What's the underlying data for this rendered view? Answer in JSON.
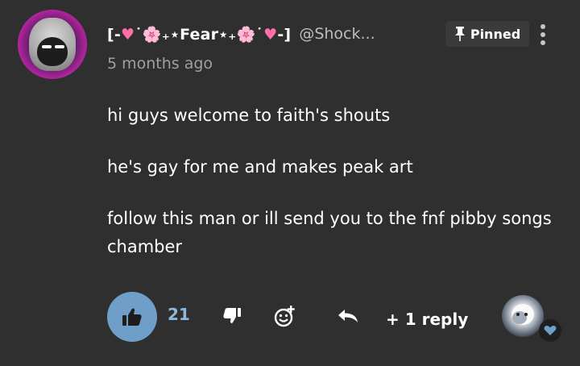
{
  "shout": {
    "author": {
      "display_name_prefix": "[-",
      "display_name_heart_left": "♥",
      "display_name_deco_left": "˙🌸₊",
      "display_name_core": "⋆Fear⋆",
      "display_name_deco_right": "₊🌸˙",
      "display_name_heart_right": "♥",
      "display_name_suffix": "-]",
      "handle": "@Shock...",
      "avatar_icon": "avatar-image"
    },
    "pinned_label": "Pinned",
    "timestamp": "5 months ago",
    "paragraphs": [
      "hi guys welcome to faith's shouts",
      "he's gay for me and makes peak art",
      "follow this man or ill send you to the fnf pibby songs chamber"
    ],
    "actions": {
      "like_count": "21",
      "reply_label": "+ 1 reply"
    }
  },
  "colors": {
    "background": "#2f2f2f",
    "accent_like": "#6f9fc9",
    "like_count": "#8fb6dc",
    "muted_text": "#a0a0a0",
    "heart": "#ff6fa8"
  }
}
